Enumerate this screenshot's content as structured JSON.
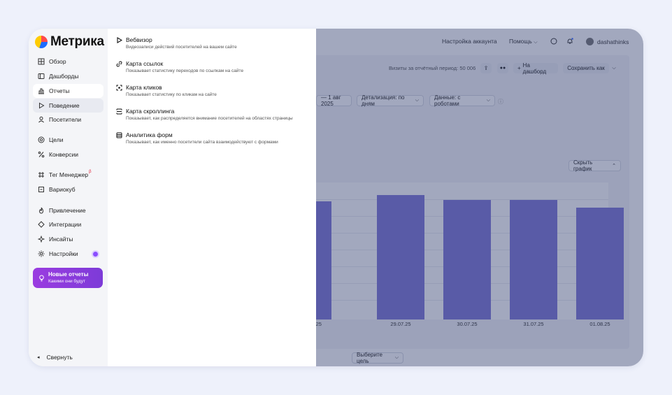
{
  "app": {
    "logo_text": "Метрика"
  },
  "sidebar": {
    "items": [
      {
        "label": "Обзор",
        "icon": "grid-icon"
      },
      {
        "label": "Дашборды",
        "icon": "dashboard-icon"
      },
      {
        "label": "Отчеты",
        "icon": "reports-icon"
      },
      {
        "label": "Поведение",
        "icon": "play-icon"
      },
      {
        "label": "Посетители",
        "icon": "user-icon"
      },
      {
        "label": "Цели",
        "icon": "target-icon"
      },
      {
        "label": "Конверсии",
        "icon": "percent-icon"
      },
      {
        "label": "Тег Менеджер",
        "icon": "tag-icon",
        "badge": "β"
      },
      {
        "label": "Вариокуб",
        "icon": "cube-icon"
      },
      {
        "label": "Привлечение",
        "icon": "flame-icon"
      },
      {
        "label": "Интеграции",
        "icon": "puzzle-icon"
      },
      {
        "label": "Инсайты",
        "icon": "insight-icon"
      },
      {
        "label": "Настройки",
        "icon": "gear-icon"
      }
    ],
    "promo": {
      "title": "Новые отчеты",
      "subtitle": "Какими они будут"
    },
    "collapse_label": "Свернуть"
  },
  "topbar": {
    "account_settings": "Настройка аккаунта",
    "help": "Помощь",
    "username": "dashathinks"
  },
  "toolbar": {
    "visits_label": "Визиты за отчётный период: 50 006",
    "add_dashboard": "На дашборд",
    "save_as": "Сохранить как"
  },
  "filters": {
    "date_range": "— 1 авг 2025",
    "detail": "Детализация: по дням",
    "data": "Данные: с роботами"
  },
  "chart_toggle": "Скрыть график",
  "goal_select": "Выберите цель",
  "chart_data": {
    "type": "bar",
    "categories": [
      "…25",
      "29.07.25",
      "30.07.25",
      "31.07.25",
      "01.08.25"
    ],
    "values": [
      0.95,
      1.0,
      0.96,
      0.96,
      0.9
    ],
    "ylim": [
      0,
      1.1
    ]
  },
  "dropdown": {
    "items": [
      {
        "title": "Вебвизор",
        "desc": "Видеозаписи действий посетителей на вашем сайте",
        "icon": "play-icon"
      },
      {
        "title": "Карта ссылок",
        "desc": "Показывает статистику переходов по ссылкам на сайте",
        "icon": "link-icon"
      },
      {
        "title": "Карта кликов",
        "desc": "Показывает статистику по кликам на сайте",
        "icon": "click-icon"
      },
      {
        "title": "Карта скроллинга",
        "desc": "Показывает, как распределяется внимание посетителей на областях страницы",
        "icon": "scroll-icon"
      },
      {
        "title": "Аналитика форм",
        "desc": "Показывает, как именно посетители сайта взаимодействуют с формами",
        "icon": "form-icon"
      }
    ]
  }
}
